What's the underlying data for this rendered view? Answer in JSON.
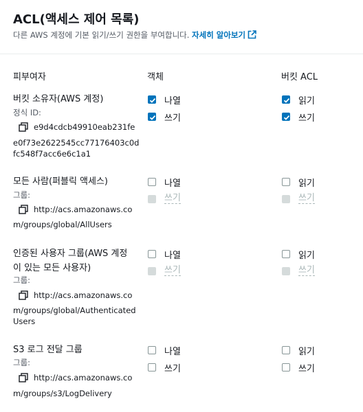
{
  "header": {
    "title": "ACL(액세스 제어 목록)",
    "description": "다른 AWS 계정에 기본 읽기/쓰기 권한을 부여합니다.",
    "learn_more": "자세히 알아보기"
  },
  "columns": {
    "grantee": "피부여자",
    "objects": "객체",
    "bucket_acl": "버킷 ACL"
  },
  "grantees": [
    {
      "name": "버킷 소유자(AWS 계정)",
      "sublabel": "정식 ID:",
      "id_lines": [
        "e9d4cdcb49910eab231fe",
        "e0f73e2622545cc77176403c0d",
        "fc548f7acc6e6c1a1"
      ],
      "objects": {
        "list_label": "나열",
        "list_checked": true,
        "write_label": "쓰기",
        "write_checked": true,
        "write_disabled": false
      },
      "bucket_acl": {
        "read_label": "읽기",
        "read_checked": true,
        "write_label": "쓰기",
        "write_checked": true,
        "write_disabled": false
      }
    },
    {
      "name": "모든 사람(퍼블릭 액세스)",
      "sublabel": "그룹:",
      "id_lines": [
        "http://acs.amazonaws.co",
        "m/groups/global/AllUsers"
      ],
      "objects": {
        "list_label": "나열",
        "list_checked": false,
        "write_label": "쓰기",
        "write_checked": false,
        "write_disabled": true
      },
      "bucket_acl": {
        "read_label": "읽기",
        "read_checked": false,
        "write_label": "쓰기",
        "write_checked": false,
        "write_disabled": true
      }
    },
    {
      "name": "인증된 사용자 그룹(AWS 계정이 있는 모든 사용자)",
      "sublabel": "그룹:",
      "id_lines": [
        "http://acs.amazonaws.co",
        "m/groups/global/Authenticated",
        "Users"
      ],
      "objects": {
        "list_label": "나열",
        "list_checked": false,
        "write_label": "쓰기",
        "write_checked": false,
        "write_disabled": true
      },
      "bucket_acl": {
        "read_label": "읽기",
        "read_checked": false,
        "write_label": "쓰기",
        "write_checked": false,
        "write_disabled": true
      }
    },
    {
      "name": "S3 로그 전달 그룹",
      "sublabel": "그룹:",
      "id_lines": [
        "http://acs.amazonaws.co",
        "m/groups/s3/LogDelivery"
      ],
      "objects": {
        "list_label": "나열",
        "list_checked": false,
        "write_label": "쓰기",
        "write_checked": false,
        "write_disabled": false
      },
      "bucket_acl": {
        "read_label": "읽기",
        "read_checked": false,
        "write_label": "쓰기",
        "write_checked": false,
        "write_disabled": false
      }
    }
  ]
}
